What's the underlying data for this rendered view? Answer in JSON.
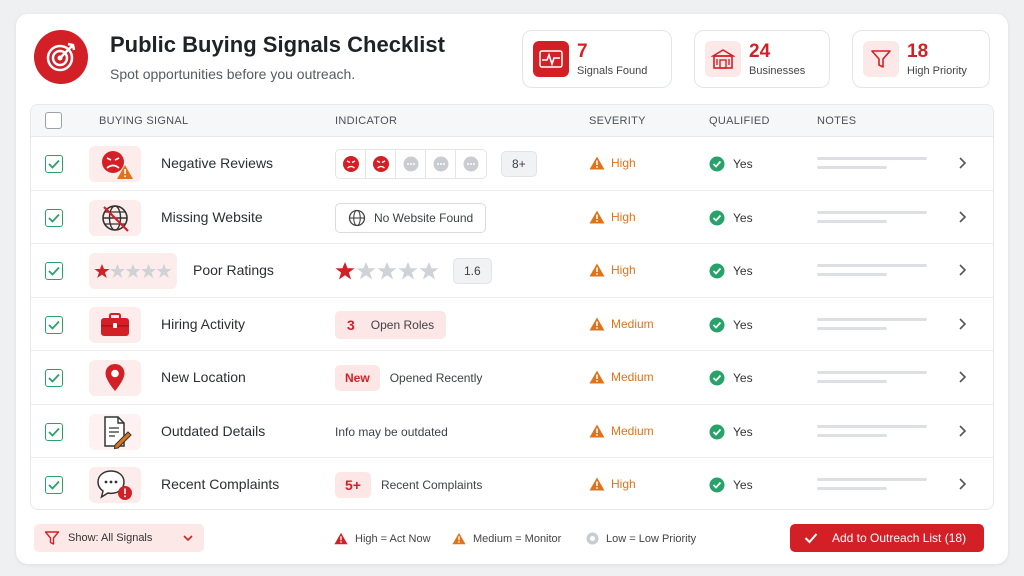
{
  "header": {
    "title": "Public Buying Signals Checklist",
    "subtitle": "Spot opportunities before you outreach."
  },
  "stats": [
    {
      "value": "7",
      "label": "Signals Found",
      "icon": "pulse-icon"
    },
    {
      "value": "24",
      "label": "Businesses",
      "icon": "storefront-icon"
    },
    {
      "value": "18",
      "label": "High Priority",
      "icon": "filter-icon"
    }
  ],
  "columns": {
    "signal": "BUYING SIGNAL",
    "indicator": "INDICATOR",
    "severity": "SEVERITY",
    "qualified": "QUALIFIED",
    "notes": "NOTES"
  },
  "rows": [
    {
      "name": "Negative Reviews",
      "icon": "angry-face-warning-icon",
      "indicator": {
        "count": "8+"
      },
      "severity": "High",
      "qualified": "Yes"
    },
    {
      "name": "Missing Website",
      "icon": "no-globe-icon",
      "indicator": {
        "text": "No Website Found"
      },
      "severity": "High",
      "qualified": "Yes"
    },
    {
      "name": "Poor Ratings",
      "icon": "one-star-icon",
      "indicator": {
        "rating": "1.6",
        "stars": 1
      },
      "severity": "High",
      "qualified": "Yes"
    },
    {
      "name": "Hiring Activity",
      "icon": "briefcase-icon",
      "indicator": {
        "value": "3",
        "text": "Open Roles"
      },
      "severity": "Medium",
      "qualified": "Yes"
    },
    {
      "name": "New Location",
      "icon": "map-pin-icon",
      "indicator": {
        "badge": "New",
        "text": "Opened Recently"
      },
      "severity": "Medium",
      "qualified": "Yes"
    },
    {
      "name": "Outdated Details",
      "icon": "document-edit-icon",
      "indicator": {
        "text": "Info may be outdated"
      },
      "severity": "Medium",
      "qualified": "Yes"
    },
    {
      "name": "Recent Complaints",
      "icon": "chat-alert-icon",
      "indicator": {
        "badge": "5+",
        "text": "Recent Complaints"
      },
      "severity": "High",
      "qualified": "Yes"
    }
  ],
  "footer": {
    "filter_label": "Show: All Signals",
    "legend_high": "High = Act Now",
    "legend_medium": "Medium = Monitor",
    "legend_low": "Low = Low Priority",
    "cta_label": "Add to Outreach List (18)"
  },
  "colors": {
    "accent": "#d32027",
    "warning": "#e0731a",
    "success": "#27a36a"
  }
}
